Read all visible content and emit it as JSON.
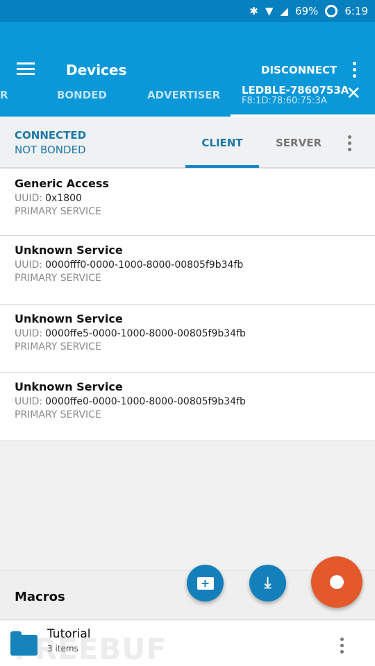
{
  "status_bar": {
    "battery": "69%",
    "time": "6:19"
  },
  "app_bar": {
    "title": "Devices",
    "disconnect_label": "DISCONNECT"
  },
  "device_tabs": {
    "partial_tab": "R",
    "bonded": "BONDED",
    "advertiser": "ADVERTISER",
    "device_name": "LEDBLE-7860753A",
    "device_mac": "F8:1D:78:60:75:3A"
  },
  "connection": {
    "state": "CONNECTED",
    "bond_state": "NOT BONDED",
    "client_tab": "CLIENT",
    "server_tab": "SERVER"
  },
  "services": [
    {
      "name": "Generic Access",
      "uuid_label": "UUID:",
      "uuid": "0x1800",
      "type": "PRIMARY SERVICE"
    },
    {
      "name": "Unknown Service",
      "uuid_label": "UUID:",
      "uuid": "0000fff0-0000-1000-8000-00805f9b34fb",
      "type": "PRIMARY SERVICE"
    },
    {
      "name": "Unknown Service",
      "uuid_label": "UUID:",
      "uuid": "0000ffe5-0000-1000-8000-00805f9b34fb",
      "type": "PRIMARY SERVICE"
    },
    {
      "name": "Unknown Service",
      "uuid_label": "UUID:",
      "uuid": "0000ffe0-0000-1000-8000-00805f9b34fb",
      "type": "PRIMARY SERVICE"
    }
  ],
  "macros": {
    "title": "Macros",
    "items": [
      {
        "name": "Tutorial",
        "count": "3 items"
      }
    ]
  },
  "watermark": "FREEBUF",
  "colors": {
    "app_bar": "#0a98d9",
    "status_bar": "#0780bf",
    "accent": "#1b78a8",
    "record_fab": "#e4592b",
    "fab": "#1480bb"
  }
}
